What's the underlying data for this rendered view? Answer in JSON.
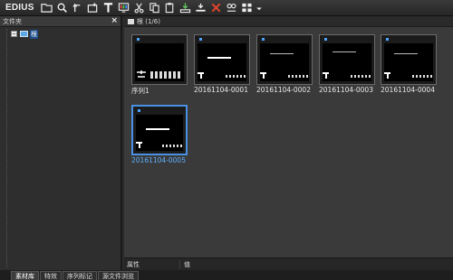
{
  "app": {
    "name": "EDIUS"
  },
  "toolbar": {
    "buttons": [
      {
        "id": "open-folder",
        "icon": "folder-icon"
      },
      {
        "id": "search",
        "icon": "search-icon"
      },
      {
        "id": "up",
        "icon": "up-arrow-icon"
      },
      {
        "id": "new-sequence",
        "icon": "new-sequence-icon"
      },
      {
        "id": "title",
        "icon": "title-t-icon"
      },
      {
        "id": "color-bar",
        "icon": "color-bar-icon"
      },
      {
        "id": "cut",
        "icon": "scissors-icon"
      },
      {
        "id": "copy",
        "icon": "copy-icon"
      },
      {
        "id": "paste",
        "icon": "paste-icon"
      },
      {
        "id": "add-to-timeline",
        "icon": "add-to-timeline-icon"
      },
      {
        "id": "insert",
        "icon": "insert-icon"
      },
      {
        "id": "delete",
        "icon": "delete-x-icon"
      },
      {
        "id": "properties",
        "icon": "properties-icon"
      },
      {
        "id": "view",
        "icon": "view-grid-icon"
      },
      {
        "id": "more",
        "icon": "dropdown-icon"
      }
    ],
    "colors": {
      "delete": "#e0452b",
      "accent": "#4a90e2"
    }
  },
  "folder_pane": {
    "title": "文件夹",
    "close_label": "×",
    "tree": [
      {
        "label": "根",
        "expanded": true
      }
    ]
  },
  "bin": {
    "header": "根 (1/6)",
    "clips": [
      {
        "name": "序列1",
        "kind": "sequence",
        "selected": false
      },
      {
        "name": "20161104-0001",
        "kind": "title",
        "selected": false
      },
      {
        "name": "20161104-0002",
        "kind": "title",
        "selected": false
      },
      {
        "name": "20161104-0003",
        "kind": "title",
        "selected": false
      },
      {
        "name": "20161104-0004",
        "kind": "title",
        "selected": false
      },
      {
        "name": "20161104-0005",
        "kind": "title",
        "selected": true
      }
    ]
  },
  "properties": {
    "col_a": "属性",
    "col_b": "值"
  },
  "tabs": [
    {
      "label": "素材库",
      "active": true
    },
    {
      "label": "特效",
      "active": false
    },
    {
      "label": "序列标记",
      "active": false
    },
    {
      "label": "源文件浏览",
      "active": false
    }
  ]
}
